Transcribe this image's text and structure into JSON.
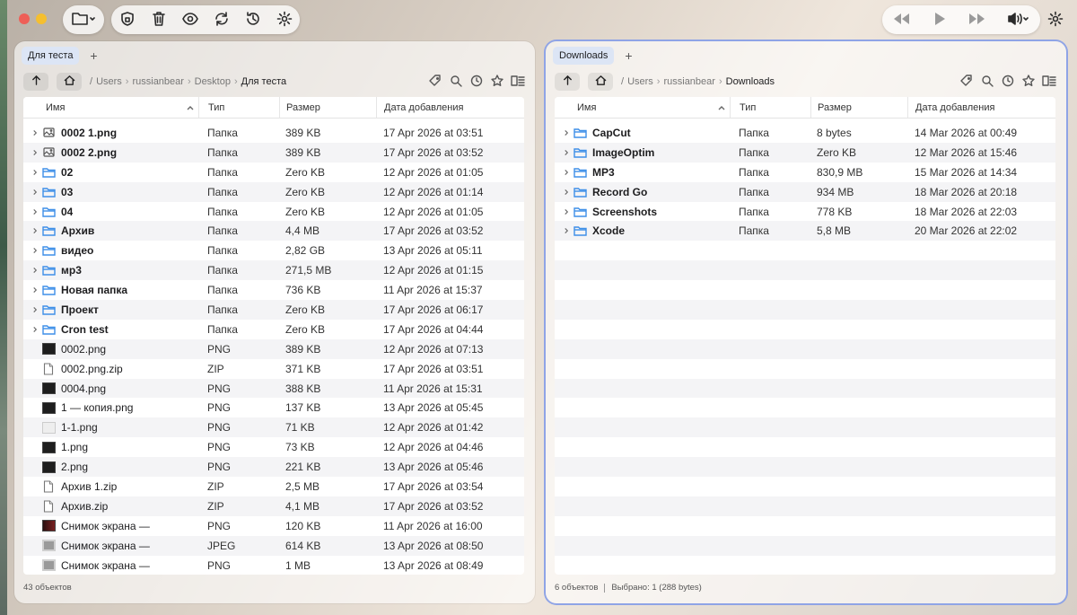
{
  "colors": {
    "accent": "#3e8fe8",
    "active_border": "#8fa4e6",
    "close": "#ee5f57",
    "minimize": "#f5bf2f"
  },
  "left": {
    "tab": "Для теста",
    "path": [
      "Users",
      "russianbear",
      "Desktop",
      "Для теста"
    ],
    "root_sep": "/",
    "headers": {
      "name": "Имя",
      "type": "Тип",
      "size": "Размер",
      "date": "Дата добавления"
    },
    "rows": [
      {
        "name": "0002 1.png",
        "type": "Папка",
        "size": "389 KB",
        "date": "17 Apr 2026 at 03:51",
        "kind": "imgfolder",
        "expand": true,
        "bold": true
      },
      {
        "name": "0002 2.png",
        "type": "Папка",
        "size": "389 KB",
        "date": "17 Apr 2026 at 03:52",
        "kind": "imgfolder",
        "expand": true,
        "bold": true
      },
      {
        "name": "02",
        "type": "Папка",
        "size": "Zero KB",
        "date": "12 Apr 2026 at 01:05",
        "kind": "folder",
        "expand": true,
        "bold": true
      },
      {
        "name": "03",
        "type": "Папка",
        "size": "Zero KB",
        "date": "12 Apr 2026 at 01:14",
        "kind": "folder",
        "expand": true,
        "bold": true
      },
      {
        "name": "04",
        "type": "Папка",
        "size": "Zero KB",
        "date": "12 Apr 2026 at 01:05",
        "kind": "folder",
        "expand": true,
        "bold": true
      },
      {
        "name": "Архив",
        "type": "Папка",
        "size": "4,4 MB",
        "date": "17 Apr 2026 at 03:52",
        "kind": "folder",
        "expand": true,
        "bold": true
      },
      {
        "name": "видео",
        "type": "Папка",
        "size": "2,82 GB",
        "date": "13 Apr 2026 at 05:11",
        "kind": "folder",
        "expand": true,
        "bold": true
      },
      {
        "name": "мр3",
        "type": "Папка",
        "size": "271,5 MB",
        "date": "12 Apr 2026 at 01:15",
        "kind": "folder",
        "expand": true,
        "bold": true
      },
      {
        "name": "Новая папка",
        "type": "Папка",
        "size": "736 KB",
        "date": "11 Apr 2026 at 15:37",
        "kind": "folder",
        "expand": true,
        "bold": true
      },
      {
        "name": "Проект",
        "type": "Папка",
        "size": "Zero KB",
        "date": "17 Apr 2026 at 06:17",
        "kind": "folder",
        "expand": true,
        "bold": true
      },
      {
        "name": "Cron test",
        "type": "Папка",
        "size": "Zero KB",
        "date": "17 Apr 2026 at 04:44",
        "kind": "folder",
        "expand": true,
        "bold": true
      },
      {
        "name": "0002.png",
        "type": "PNG",
        "size": "389 KB",
        "date": "12 Apr 2026 at 07:13",
        "kind": "thumb",
        "expand": false,
        "bold": false
      },
      {
        "name": "0002.png.zip",
        "type": "ZIP",
        "size": "371 KB",
        "date": "17 Apr 2026 at 03:51",
        "kind": "doc",
        "expand": false,
        "bold": false
      },
      {
        "name": "0004.png",
        "type": "PNG",
        "size": "388 KB",
        "date": "11 Apr 2026 at 15:31",
        "kind": "thumb",
        "expand": false,
        "bold": false
      },
      {
        "name": "1 — копия.png",
        "type": "PNG",
        "size": "137 KB",
        "date": "13 Apr 2026 at 05:45",
        "kind": "thumb",
        "expand": false,
        "bold": false
      },
      {
        "name": "1-1.png",
        "type": "PNG",
        "size": "71 KB",
        "date": "12 Apr 2026 at 01:42",
        "kind": "thumb-light",
        "expand": false,
        "bold": false
      },
      {
        "name": "1.png",
        "type": "PNG",
        "size": "73 KB",
        "date": "12 Apr 2026 at 04:46",
        "kind": "thumb",
        "expand": false,
        "bold": false
      },
      {
        "name": "2.png",
        "type": "PNG",
        "size": "221 KB",
        "date": "13 Apr 2026 at 05:46",
        "kind": "thumb",
        "expand": false,
        "bold": false
      },
      {
        "name": "Архив 1.zip",
        "type": "ZIP",
        "size": "2,5 MB",
        "date": "17 Apr 2026 at 03:54",
        "kind": "doc",
        "expand": false,
        "bold": false
      },
      {
        "name": "Архив.zip",
        "type": "ZIP",
        "size": "4,1 MB",
        "date": "17 Apr 2026 at 03:52",
        "kind": "doc",
        "expand": false,
        "bold": false
      },
      {
        "name": "Снимок экрана —",
        "type": "PNG",
        "size": "120 KB",
        "date": "11 Apr 2026 at 16:00",
        "kind": "thumb-red",
        "expand": false,
        "bold": false
      },
      {
        "name": "Снимок экрана —",
        "type": "JPEG",
        "size": "614 KB",
        "date": "13 Apr 2026 at 08:50",
        "kind": "thumb-gray",
        "expand": false,
        "bold": false
      },
      {
        "name": "Снимок экрана —",
        "type": "PNG",
        "size": "1 MB",
        "date": "13 Apr 2026 at 08:49",
        "kind": "thumb-gray",
        "expand": false,
        "bold": false
      }
    ],
    "status": "43 объектов"
  },
  "right": {
    "tab": "Downloads",
    "path": [
      "Users",
      "russianbear",
      "Downloads"
    ],
    "root_sep": "/",
    "headers": {
      "name": "Имя",
      "type": "Тип",
      "size": "Размер",
      "date": "Дата добавления"
    },
    "rows": [
      {
        "name": "CapCut",
        "type": "Папка",
        "size": "8 bytes",
        "date": "14 Mar 2026 at 00:49",
        "kind": "folder",
        "expand": true,
        "bold": true
      },
      {
        "name": "ImageOptim",
        "type": "Папка",
        "size": "Zero KB",
        "date": "12 Mar 2026 at 15:46",
        "kind": "folder",
        "expand": true,
        "bold": true
      },
      {
        "name": "MP3",
        "type": "Папка",
        "size": "830,9 MB",
        "date": "15 Mar 2026 at 14:34",
        "kind": "folder",
        "expand": true,
        "bold": true
      },
      {
        "name": "Record Go",
        "type": "Папка",
        "size": "934 MB",
        "date": "18 Mar 2026 at 20:18",
        "kind": "folder",
        "expand": true,
        "bold": true
      },
      {
        "name": "Screenshots",
        "type": "Папка",
        "size": "778 KB",
        "date": "18 Mar 2026 at 22:03",
        "kind": "folder",
        "expand": true,
        "bold": true
      },
      {
        "name": "Xcode",
        "type": "Папка",
        "size": "5,8 MB",
        "date": "20 Mar 2026 at 22:02",
        "kind": "folder",
        "expand": true,
        "bold": true
      }
    ],
    "empty_rows": 17,
    "status": "6 объектов",
    "selection": "Выбрано: 1 (288 bytes)"
  }
}
